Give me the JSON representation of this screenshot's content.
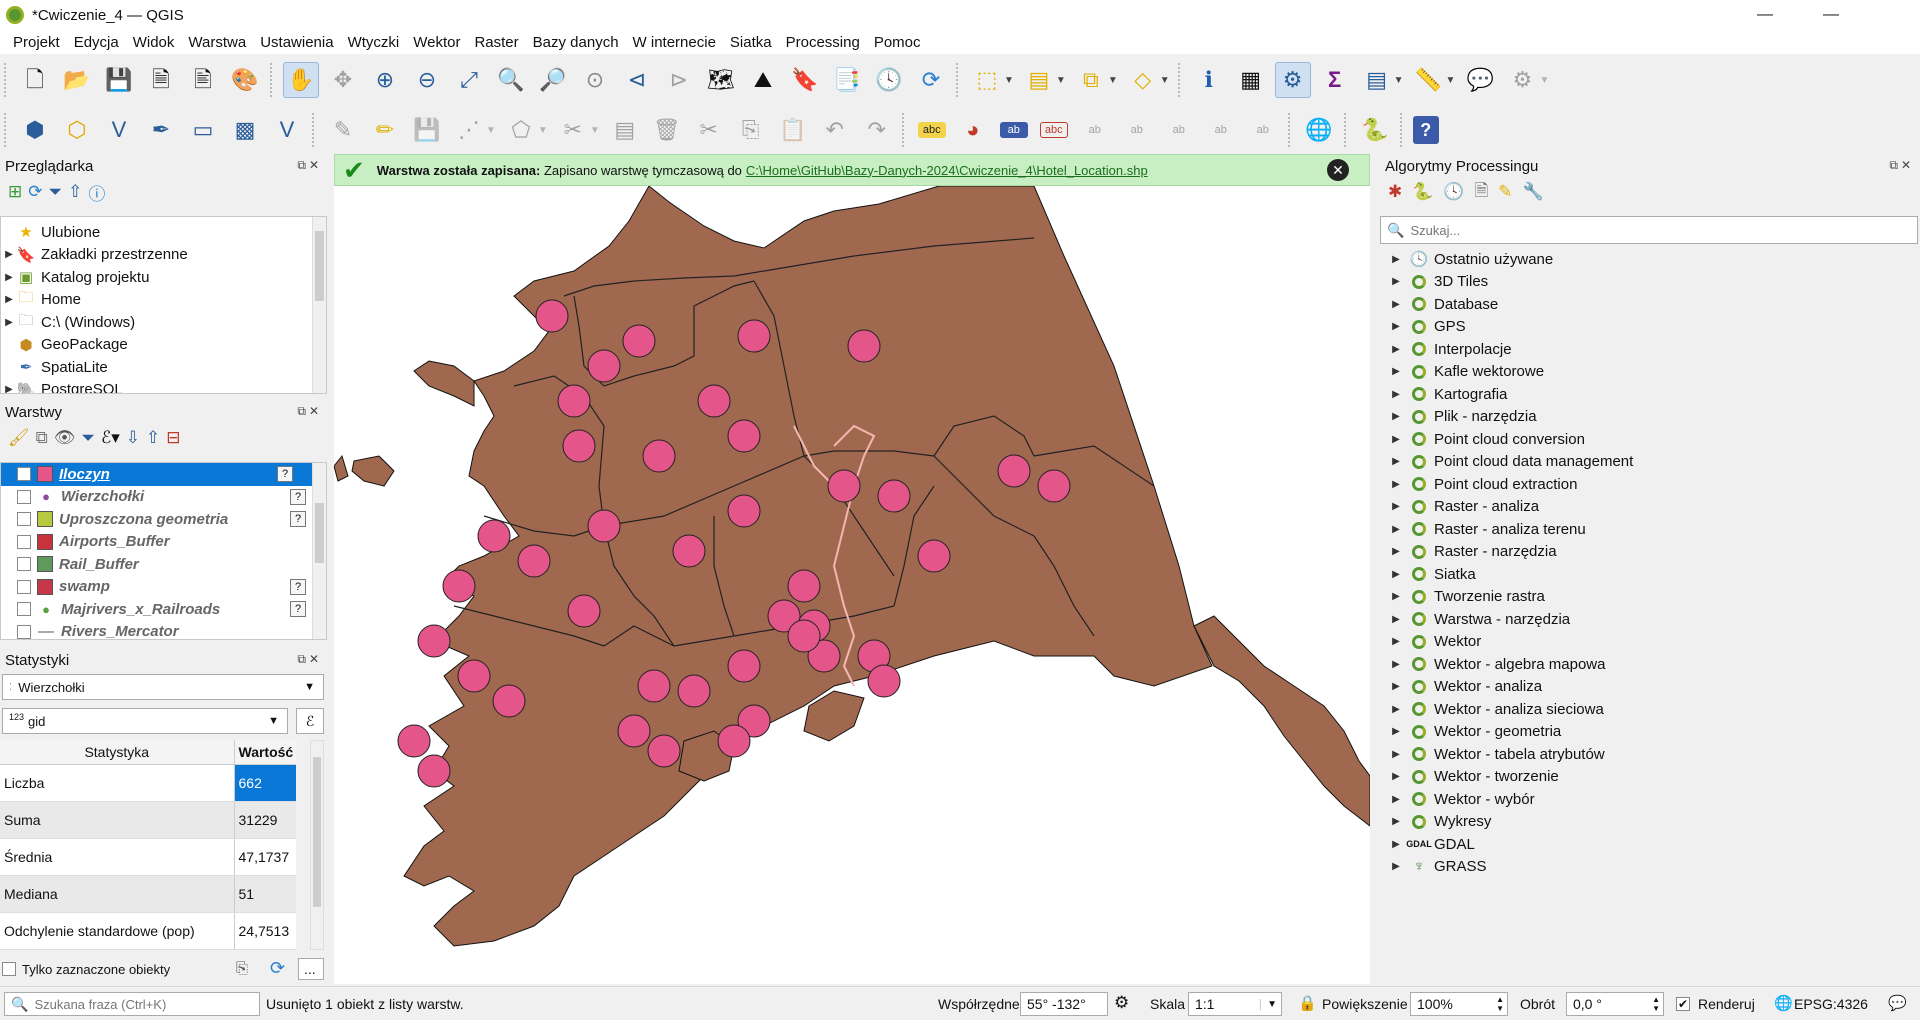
{
  "window": {
    "title": "*Cwiczenie_4 — QGIS",
    "min": "—",
    "max": "❐",
    "close": "✕"
  },
  "menu": [
    "Projekt",
    "Edycja",
    "Widok",
    "Warstwa",
    "Ustawienia",
    "Wtyczki",
    "Wektor",
    "Raster",
    "Bazy danych",
    "W internecie",
    "Siatka",
    "Processing",
    "Pomoc"
  ],
  "browser": {
    "title": "Przeglądarka",
    "items": [
      {
        "label": "Ulubione",
        "icon": "star-icon"
      },
      {
        "label": "Zakładki przestrzenne",
        "icon": "bookmark-icon"
      },
      {
        "label": "Katalog projektu",
        "icon": "project-folder-icon"
      },
      {
        "label": "Home",
        "icon": "folder-icon"
      },
      {
        "label": "C:\\ (Windows)",
        "icon": "drive-icon"
      },
      {
        "label": "GeoPackage",
        "icon": "geopackage-icon"
      },
      {
        "label": "SpatiaLite",
        "icon": "spatialite-icon"
      },
      {
        "label": "PostgreSQL",
        "icon": "postgresql-icon"
      }
    ]
  },
  "layers": {
    "title": "Warstwy",
    "items": [
      {
        "name": "Iloczyn",
        "checked": true,
        "selected": true,
        "color": "#e4558a"
      },
      {
        "name": "Wierzchołki",
        "checked": false,
        "color": "#8e4b9d",
        "kind": "point"
      },
      {
        "name": "Uproszczona geometria",
        "checked": false,
        "color": "#b7c93e"
      },
      {
        "name": "Airports_Buffer",
        "checked": false,
        "color": "#c8323c"
      },
      {
        "name": "Rail_Buffer",
        "checked": false,
        "color": "#5f9a5c"
      },
      {
        "name": "swamp",
        "checked": false,
        "color": "#c4384a"
      },
      {
        "name": "Majrivers_x_Railroads",
        "checked": false,
        "color": "#5aa040",
        "kind": "point"
      },
      {
        "name": "Rivers_Mercator",
        "checked": false,
        "color": "#aaaaaa",
        "kind": "line"
      }
    ]
  },
  "stats": {
    "title": "Statystyki",
    "layer": "Wierzchołki",
    "field": "gid",
    "field_type": "123",
    "col_stat": "Statystyka",
    "col_value": "Wartość",
    "rows": [
      {
        "name": "Liczba",
        "value": "662"
      },
      {
        "name": "Suma",
        "value": "31229"
      },
      {
        "name": "Średnia",
        "value": "47,1737"
      },
      {
        "name": "Mediana",
        "value": "51"
      },
      {
        "name": "Odchylenie standardowe (pop)",
        "value": "24,7513"
      }
    ],
    "only_selected": "Tylko zaznaczone obiekty",
    "more": "..."
  },
  "message": {
    "bold": "Warstwa została zapisana:",
    "text": "Zapisano warstwę tymczasową do",
    "link": "C:\\Home\\GitHub\\Bazy-Danych-2024\\Cwiczenie_4\\Hotel_Location.shp"
  },
  "processing": {
    "title": "Algorytmy Processingu",
    "search_placeholder": "Szukaj...",
    "items": [
      "Ostatnio używane",
      "3D Tiles",
      "Database",
      "GPS",
      "Interpolacje",
      "Kafle wektorowe",
      "Kartografia",
      "Plik - narzędzia",
      "Point cloud conversion",
      "Point cloud data management",
      "Point cloud extraction",
      "Raster - analiza",
      "Raster - analiza terenu",
      "Raster - narzędzia",
      "Siatka",
      "Tworzenie rastra",
      "Warstwa - narzędzia",
      "Wektor",
      "Wektor - algebra mapowa",
      "Wektor - analiza",
      "Wektor - analiza sieciowa",
      "Wektor - geometria",
      "Wektor - tabela atrybutów",
      "Wektor - tworzenie",
      "Wektor - wybór",
      "Wykresy",
      "GDAL",
      "GRASS"
    ]
  },
  "status": {
    "locator_placeholder": "Szukana fraza (Ctrl+K)",
    "message": "Usunięto 1 obiekt z listy warstw.",
    "coord_label": "Współrzędne",
    "coord_value": "55° -132°",
    "scale_label": "Skala",
    "scale_value": "1:1",
    "magnifier_label": "Powiększenie",
    "magnifier_value": "100%",
    "rotation_label": "Obrót",
    "rotation_value": "0,0 °",
    "render_label": "Renderuj",
    "crs": "EPSG:4326"
  },
  "colors": {
    "land": "#a0694f",
    "circle": "#e4558a",
    "border": "#222222",
    "river": "#f4b7b0",
    "accent": "#0a78d7"
  }
}
